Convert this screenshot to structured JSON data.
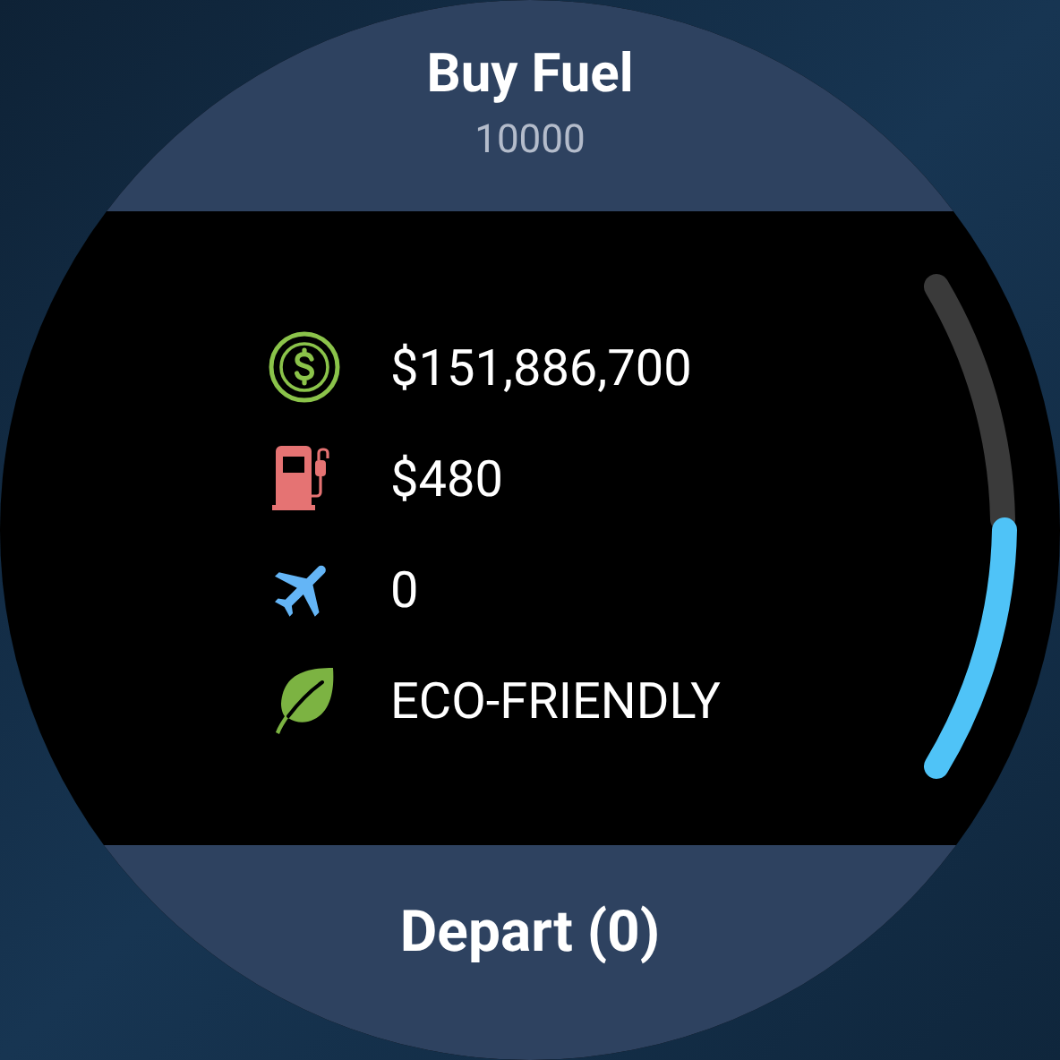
{
  "header": {
    "title": "Buy Fuel",
    "subtitle": "10000"
  },
  "stats": [
    {
      "kind": "money",
      "value": "$151,886,700"
    },
    {
      "kind": "fuel",
      "value": "$480"
    },
    {
      "kind": "plane",
      "value": "0"
    },
    {
      "kind": "eco",
      "value": "ECO-FRIENDLY"
    }
  ],
  "footer": {
    "button": "Depart (0)"
  }
}
